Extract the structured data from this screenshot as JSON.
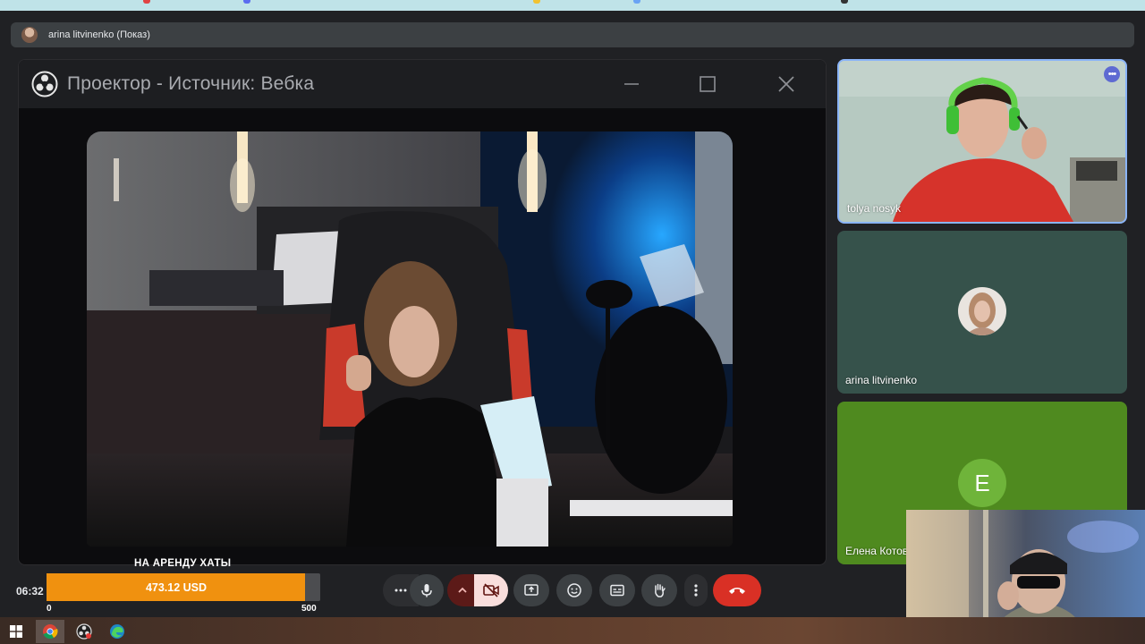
{
  "presentation_bar": {
    "label": "arina litvinenko (Показ)"
  },
  "projector": {
    "title": "Проектор - Источник: Вебка",
    "icon": "obs-icon",
    "controls": [
      "minimize-icon",
      "maximize-icon",
      "close-icon"
    ]
  },
  "participants": [
    {
      "name": "tolya nosyk",
      "speaking": true,
      "more_icon": "more-horizontal-icon"
    },
    {
      "name": "arina litvinenko",
      "avatar": "photo"
    },
    {
      "name": "Елена Котов",
      "avatar_letter": "E",
      "avatar_color": "#6fb43a"
    }
  ],
  "clock": "06:32",
  "donation_goal": {
    "title": "НА АРЕНДУ ХАТЫ",
    "amount_label": "473.12 USD",
    "min": "0",
    "max": "500",
    "progress": 0.946,
    "fill_color": "#f0910f"
  },
  "controls": {
    "more_options": "more-horizontal-icon",
    "microphone": "mic-icon",
    "expand": "chevron-up-icon",
    "camera": "camera-off-icon",
    "present": "present-screen-icon",
    "reactions": "emoji-icon",
    "captions": "captions-icon",
    "raise_hand": "hand-icon",
    "more_vertical": "more-vertical-icon",
    "leave_call": "hang-up-icon",
    "leave_color": "#d93025",
    "camera_off_bg": "#f9dedc"
  },
  "taskbar": {
    "items": [
      "windows-start-icon",
      "chrome-icon",
      "obs-taskbar-icon",
      "edge-icon"
    ]
  },
  "colors": {
    "meet_bg": "#202124",
    "speaking_border": "#8ab4f8"
  }
}
